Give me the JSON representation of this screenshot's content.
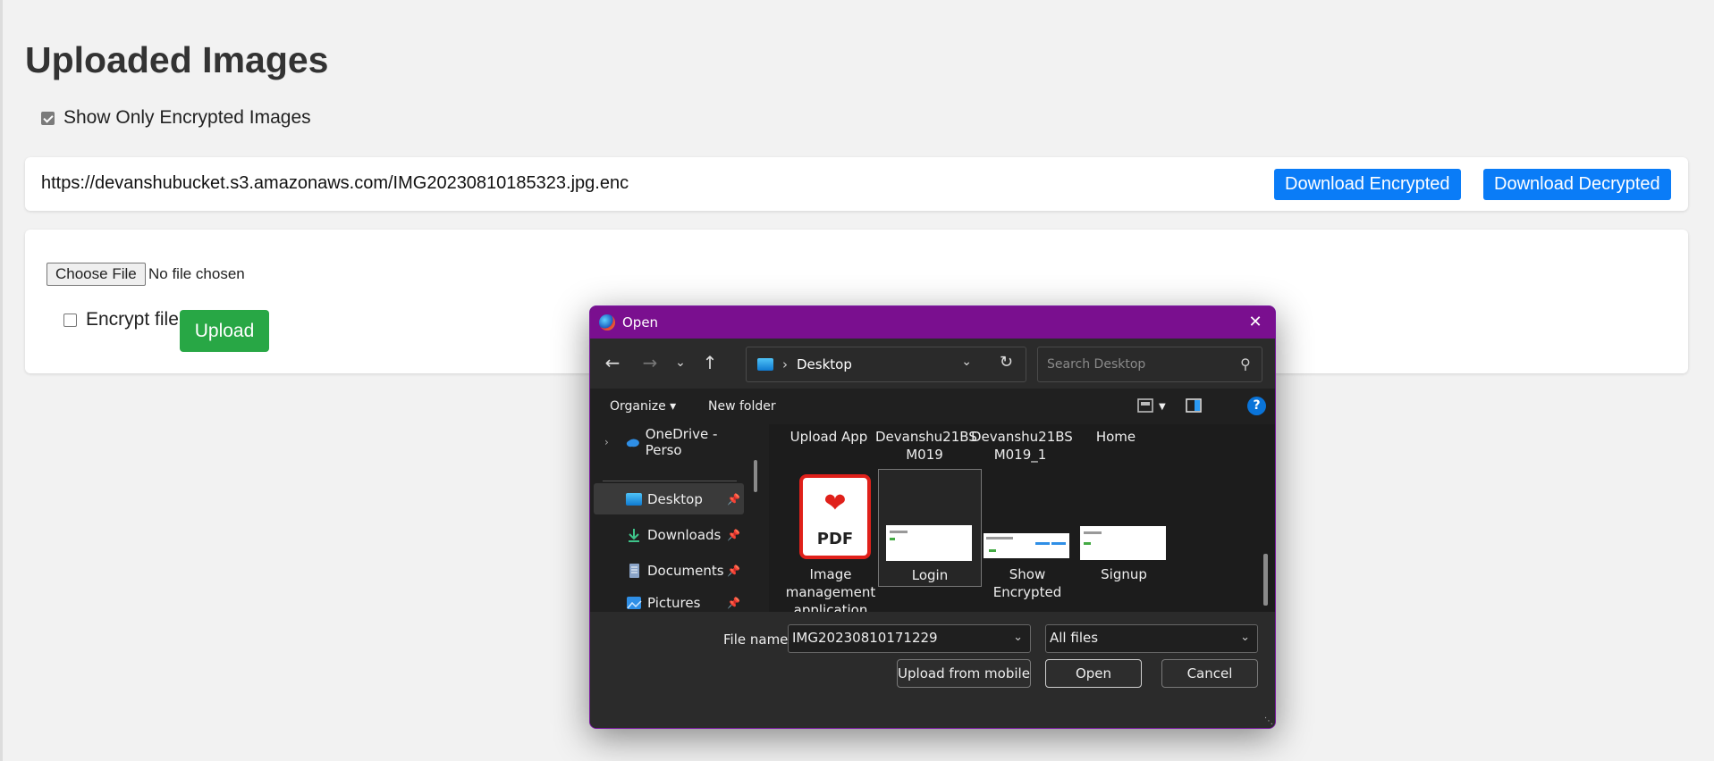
{
  "page": {
    "title": "Uploaded Images",
    "filter_label": "Show Only Encrypted Images",
    "filter_checked": true
  },
  "images": [
    {
      "url": "https://devanshubucket.s3.amazonaws.com/IMG20230810185323.jpg.enc",
      "download_encrypted": "Download Encrypted",
      "download_decrypted": "Download Decrypted"
    }
  ],
  "upload_form": {
    "choose_file": "Choose File",
    "no_file": "No file chosen",
    "encrypt_label": "Encrypt file",
    "encrypt_checked": false,
    "upload_button": "Upload"
  },
  "dialog": {
    "title": "Open",
    "close": "✕",
    "address": {
      "location": "Desktop"
    },
    "search_placeholder": "Search Desktop",
    "commands": {
      "organize": "Organize ▾",
      "new_folder": "New folder"
    },
    "nav_items": [
      {
        "label": "OneDrive - Perso",
        "icon": "onedrive-icon"
      },
      {
        "label": "Desktop",
        "icon": "desktop-folder-icon",
        "pinned": true,
        "selected": true
      },
      {
        "label": "Downloads",
        "icon": "download-icon",
        "pinned": true
      },
      {
        "label": "Documents",
        "icon": "documents-icon",
        "pinned": true
      },
      {
        "label": "Pictures",
        "icon": "pictures-icon",
        "pinned": true
      }
    ],
    "top_row_labels": [
      "Upload App",
      "Devanshu21BS M019",
      "Devanshu21BS M019_1",
      "Home"
    ],
    "files": [
      {
        "name": "Image management application",
        "type": "pdf"
      },
      {
        "name": "Login",
        "type": "image",
        "selected": true
      },
      {
        "name": "Show Encrypted",
        "type": "image"
      },
      {
        "name": "Signup",
        "type": "image"
      }
    ],
    "pdf_label": "PDF",
    "file_name_label": "File name:",
    "file_name_value": "IMG20230810171229",
    "file_type": "All files",
    "buttons": {
      "upload_mobile": "Upload from mobile",
      "open": "Open",
      "cancel": "Cancel"
    },
    "help": "?"
  },
  "colors": {
    "blue_button": "#0a7cf7",
    "green_button": "#28a745",
    "dialog_titlebar": "#7a0f8f"
  }
}
